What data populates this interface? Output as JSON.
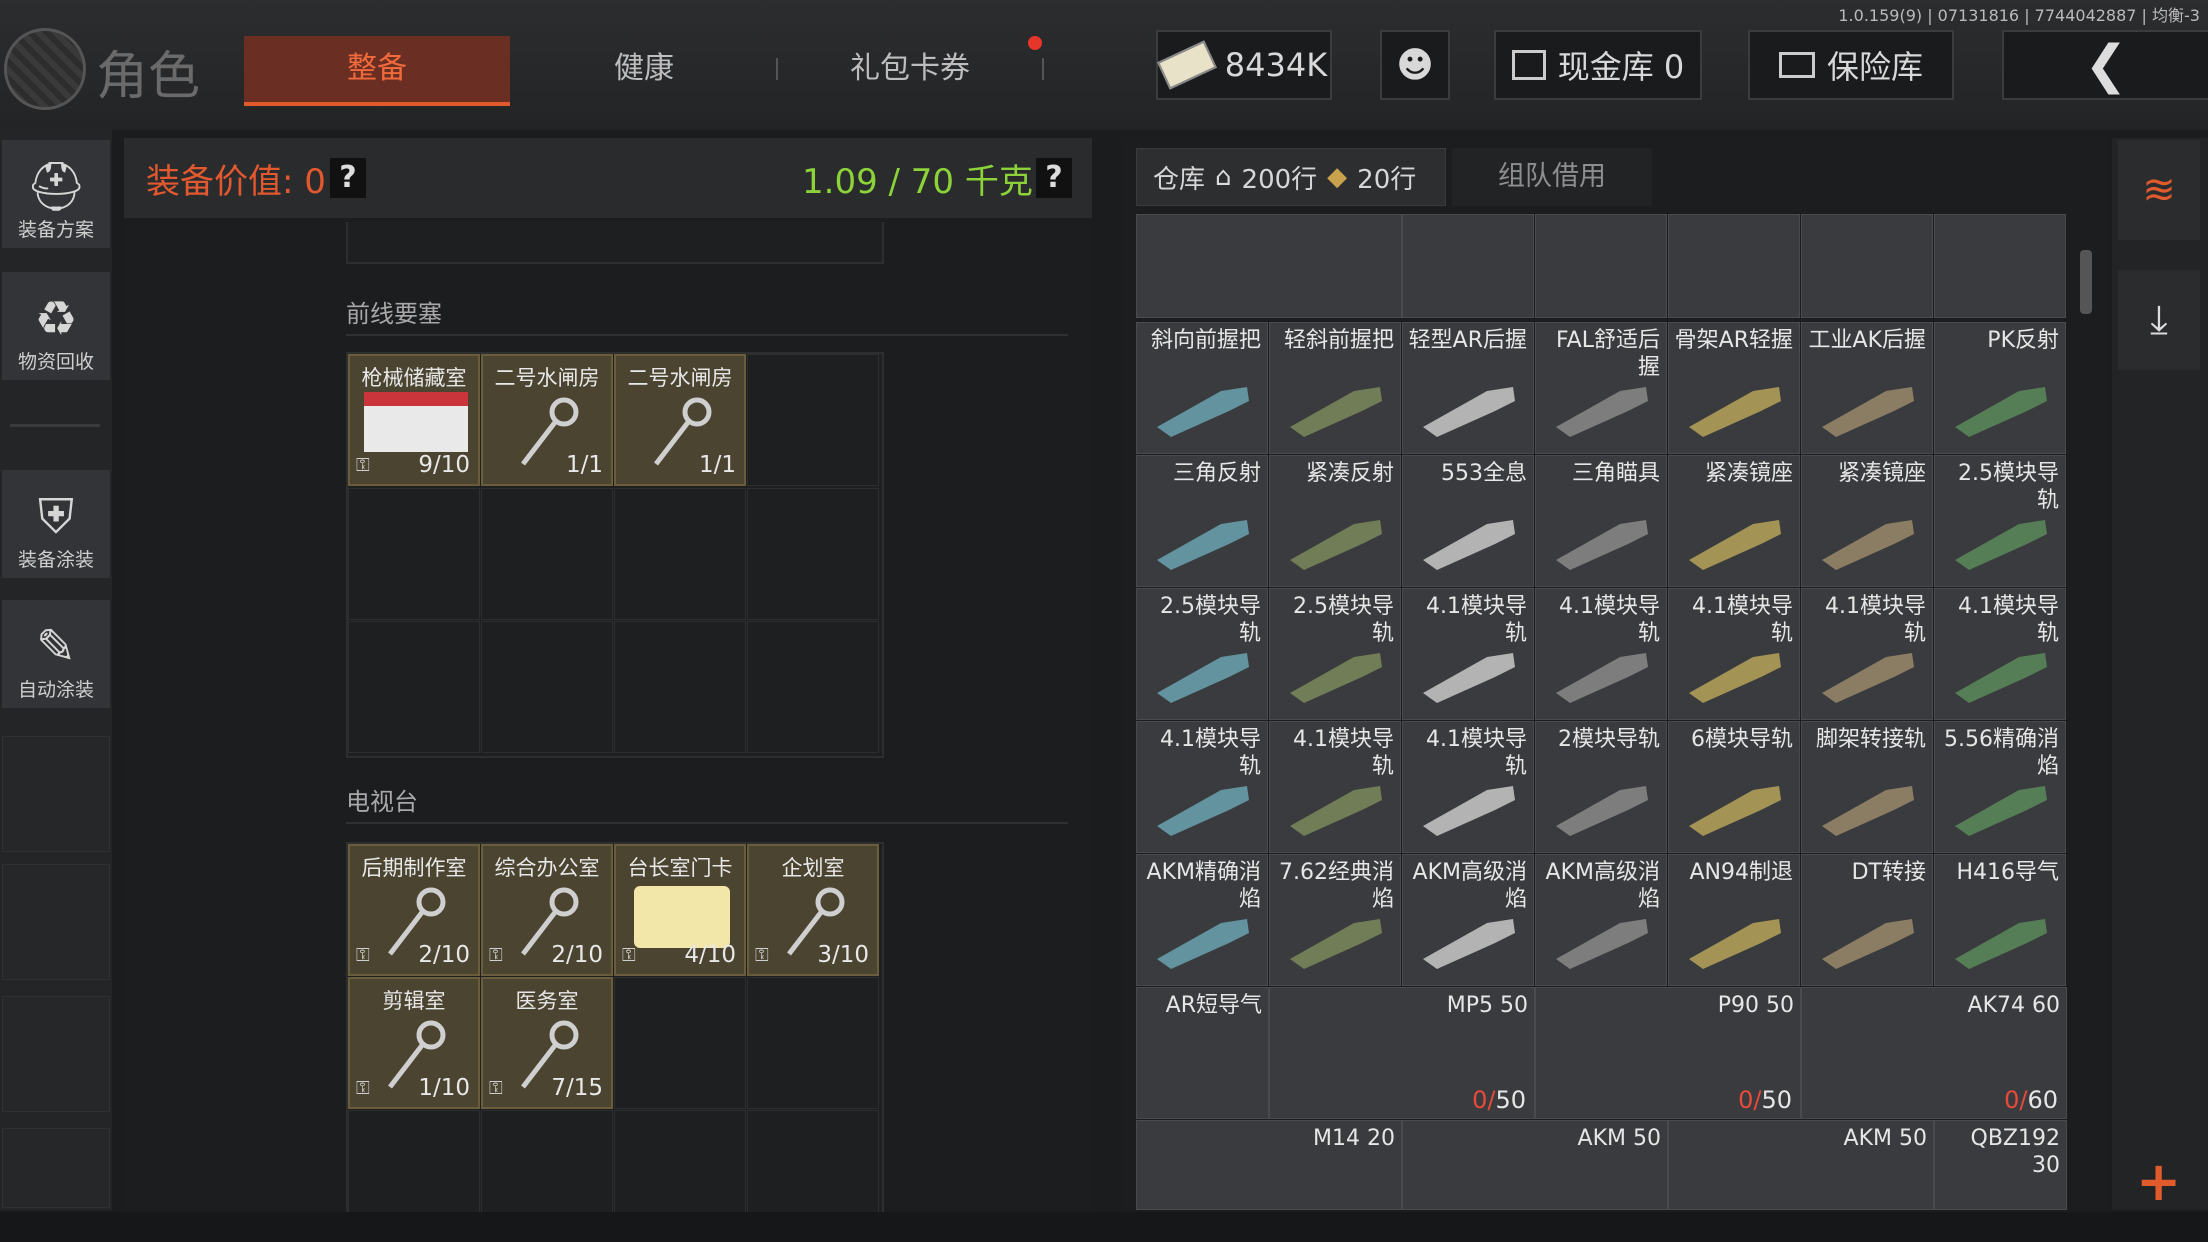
{
  "version_info": "1.0.159(9) | 07131816 | 7744042887 | 均衡-3",
  "header": {
    "title": "角色",
    "tabs": [
      {
        "label": "整备",
        "active": true
      },
      {
        "label": "健康",
        "active": false
      },
      {
        "label": "礼包卡券",
        "active": false
      }
    ],
    "currency": "8434K",
    "cash_vault": "现金库 0",
    "safe_box": "保险库"
  },
  "sidebar": {
    "items": [
      {
        "label": "装备方案",
        "icon": "helmet-icon"
      },
      {
        "label": "物资回收",
        "icon": "recycle-icon"
      },
      {
        "label": "装备涂装",
        "icon": "paint-icon"
      },
      {
        "label": "自动涂装",
        "icon": "spray-icon"
      }
    ]
  },
  "equipment": {
    "value_label": "装备价值: 0",
    "help": "?",
    "weight": "1.09 / 70 千克",
    "sections": [
      {
        "title": "前线要塞",
        "keys": [
          {
            "name": "枪械储藏室",
            "count": "9/10"
          },
          {
            "name": "二号水闸房",
            "count": "1/1"
          },
          {
            "name": "二号水闸房",
            "count": "1/1"
          }
        ]
      },
      {
        "title": "电视台",
        "keys": [
          {
            "name": "后期制作室",
            "count": "2/10"
          },
          {
            "name": "综合办公室",
            "count": "2/10"
          },
          {
            "name": "台长室门卡",
            "count": "4/10"
          },
          {
            "name": "企划室",
            "count": "3/10"
          },
          {
            "name": "剪辑室",
            "count": "1/10"
          },
          {
            "name": "医务室",
            "count": "7/15"
          }
        ]
      }
    ]
  },
  "warehouse": {
    "tab_label": "仓库",
    "rows": "200行",
    "extra_rows": "20行",
    "team_tab": "组队借用",
    "items": [
      {
        "name": "斜向前握把"
      },
      {
        "name": "轻斜前握把"
      },
      {
        "name": "轻型AR后握"
      },
      {
        "name": "FAL舒适后握"
      },
      {
        "name": "骨架AR轻握"
      },
      {
        "name": "工业AK后握"
      },
      {
        "name": "PK反射"
      },
      {
        "name": "三角反射"
      },
      {
        "name": "紧凑反射"
      },
      {
        "name": "553全息"
      },
      {
        "name": "三角瞄具"
      },
      {
        "name": "紧凑镜座"
      },
      {
        "name": "紧凑镜座"
      },
      {
        "name": "2.5模块导轨"
      },
      {
        "name": "2.5模块导轨"
      },
      {
        "name": "2.5模块导轨"
      },
      {
        "name": "4.1模块导轨"
      },
      {
        "name": "4.1模块导轨"
      },
      {
        "name": "4.1模块导轨"
      },
      {
        "name": "4.1模块导轨"
      },
      {
        "name": "4.1模块导轨"
      },
      {
        "name": "4.1模块导轨"
      },
      {
        "name": "4.1模块导轨"
      },
      {
        "name": "4.1模块导轨"
      },
      {
        "name": "2模块导轨"
      },
      {
        "name": "6模块导轨"
      },
      {
        "name": "脚架转接轨"
      },
      {
        "name": "5.56精确消焰"
      },
      {
        "name": "AKM精确消焰"
      },
      {
        "name": "7.62经典消焰"
      },
      {
        "name": "AKM高级消焰"
      },
      {
        "name": "AKM高级消焰"
      },
      {
        "name": "AN94制退"
      },
      {
        "name": "DT转接"
      },
      {
        "name": "H416导气"
      }
    ],
    "magazines": [
      {
        "name": "AR短导气"
      },
      {
        "name": "MP5 50",
        "count": "50",
        "zero": "0/"
      },
      {
        "name": "P90 50",
        "count": "50",
        "zero": "0/"
      },
      {
        "name": "AK74 60",
        "count": "60",
        "zero": "0/"
      }
    ],
    "bottom_items": [
      {
        "name": "M14 20"
      },
      {
        "name": "AKM 50"
      },
      {
        "name": "AKM 50"
      },
      {
        "name": "QBZ192 30"
      }
    ]
  }
}
